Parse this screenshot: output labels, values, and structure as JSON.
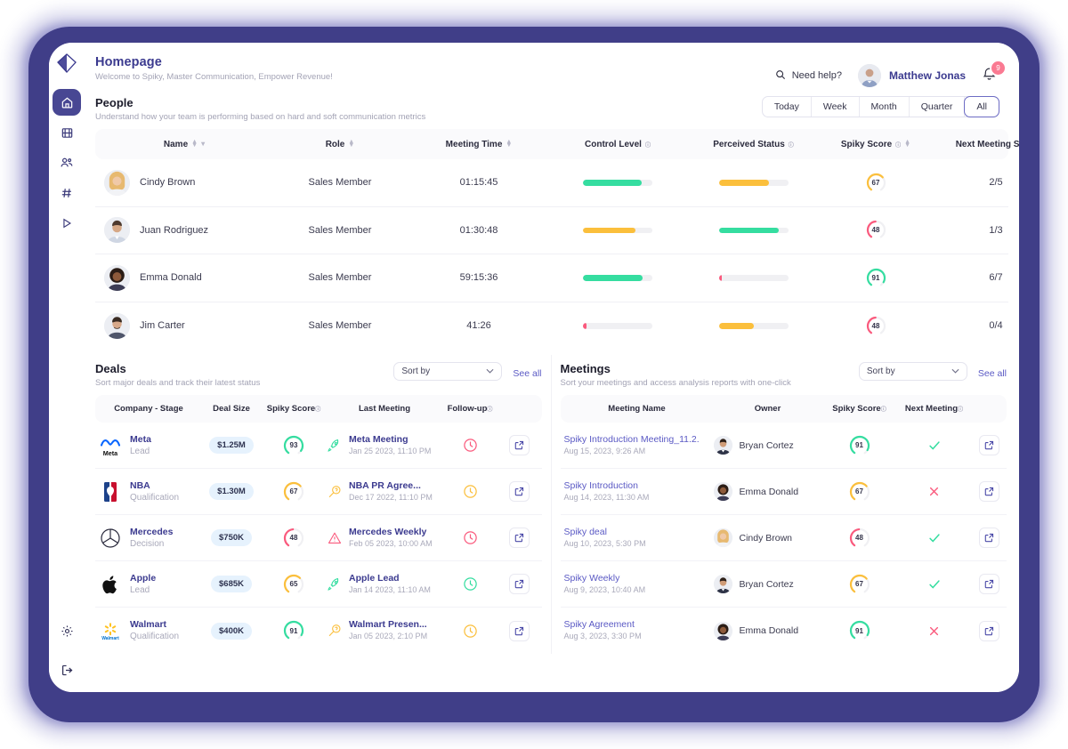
{
  "app": {
    "logo_icon": "spiky-prism-logo"
  },
  "sidebar": {
    "items": [
      {
        "name": "home",
        "icon": "home-icon",
        "active": true
      },
      {
        "name": "library",
        "icon": "film-grid-icon",
        "active": false
      },
      {
        "name": "teams",
        "icon": "people-icon",
        "active": false
      },
      {
        "name": "channels",
        "icon": "hash-icon",
        "active": false
      },
      {
        "name": "recordings",
        "icon": "play-icon",
        "active": false
      }
    ],
    "bottom": [
      {
        "name": "settings",
        "icon": "gear-icon"
      },
      {
        "name": "logout",
        "icon": "logout-icon"
      }
    ]
  },
  "header": {
    "title": "Homepage",
    "subtitle": "Welcome to Spiky, Master Communication, Empower Revenue!",
    "need_help": "Need help?",
    "search_icon": "search-icon",
    "user_name": "Matthew Jonas",
    "bell_icon": "bell-icon",
    "notification_count": "9"
  },
  "people": {
    "title": "People",
    "subtitle": "Understand how your team is performing based on hard and soft communication metrics",
    "period_tabs": [
      {
        "label": "Today",
        "active": false
      },
      {
        "label": "Week",
        "active": false
      },
      {
        "label": "Month",
        "active": false
      },
      {
        "label": "Quarter",
        "active": false
      },
      {
        "label": "All",
        "active": true
      }
    ],
    "columns": [
      {
        "label": "Name",
        "sortable": true,
        "filter": true,
        "info": false
      },
      {
        "label": "Role",
        "sortable": true,
        "filter": false,
        "info": false
      },
      {
        "label": "Meeting Time",
        "sortable": true,
        "filter": false,
        "info": false
      },
      {
        "label": "Control Level",
        "sortable": false,
        "filter": false,
        "info": true
      },
      {
        "label": "Perceived Status",
        "sortable": false,
        "filter": false,
        "info": true
      },
      {
        "label": "Spiky Score",
        "sortable": true,
        "filter": false,
        "info": true
      },
      {
        "label": "Next Meeting Set",
        "sortable": false,
        "filter": false,
        "info": true
      }
    ],
    "rows": [
      {
        "name": "Cindy Brown",
        "role": "Sales Member",
        "meeting_time": "01:15:45",
        "control_level": 84,
        "control_color": "#35ddA0",
        "perceived_status": 72,
        "perceived_color": "#fbbf3c",
        "spiky_score": 67,
        "spiky_color": "#fbbf3c",
        "next_meeting_set": "2/5",
        "avatar": "avatar-cindy-brown"
      },
      {
        "name": "Juan Rodriguez",
        "role": "Sales Member",
        "meeting_time": "01:30:48",
        "control_level": 76,
        "control_color": "#fbbf3c",
        "perceived_status": 86,
        "perceived_color": "#35ddA0",
        "spiky_score": 48,
        "spiky_color": "#fa5a7d",
        "next_meeting_set": "1/3",
        "avatar": "avatar-juan-rodriguez"
      },
      {
        "name": "Emma Donald",
        "role": "Sales Member",
        "meeting_time": "59:15:36",
        "control_level": 86,
        "control_color": "#35ddA0",
        "perceived_status": 5,
        "perceived_color": "#fa5a7d",
        "spiky_score": 91,
        "spiky_color": "#35ddA0",
        "next_meeting_set": "6/7",
        "avatar": "avatar-emma-donald"
      },
      {
        "name": "Jim Carter",
        "role": "Sales Member",
        "meeting_time": "41:26",
        "control_level": 5,
        "control_color": "#fa5a7d",
        "perceived_status": 50,
        "perceived_color": "#fbbf3c",
        "spiky_score": 48,
        "spiky_color": "#fa5a7d",
        "next_meeting_set": "0/4",
        "avatar": "avatar-jim-carter"
      }
    ]
  },
  "deals": {
    "title": "Deals",
    "subtitle": "Sort major deals and track their latest status",
    "sort_by": "Sort by",
    "see_all": "See all",
    "columns": [
      {
        "label": "Company - Stage",
        "info": false
      },
      {
        "label": "Deal Size",
        "info": false
      },
      {
        "label": "Spiky Score",
        "info": true
      },
      {
        "label": "Last Meeting",
        "info": false
      },
      {
        "label": "Follow-up",
        "info": true
      }
    ],
    "rows": [
      {
        "company": "Meta",
        "stage": "Lead",
        "logo": "meta-logo",
        "deal_size": "$1.25M",
        "spiky_score": 93,
        "spiky_color": "#35ddA0",
        "meeting_name": "Meta Meeting",
        "meeting_date": "Jan 25 2023, 11:10 PM",
        "meeting_icon": "rocket-icon",
        "meeting_icon_color": "#35ddA0",
        "followup_icon": "clock-icon",
        "followup_color": "#fa5a7d"
      },
      {
        "company": "NBA",
        "stage": "Qualification",
        "logo": "nba-logo",
        "deal_size": "$1.30M",
        "spiky_score": 67,
        "spiky_color": "#fbbf3c",
        "meeting_name": "NBA PR Agree...",
        "meeting_date": "Dec 17 2022, 11:10 PM",
        "meeting_icon": "magnifier-question-icon",
        "meeting_icon_color": "#fbbf3c",
        "followup_icon": "clock-icon",
        "followup_color": "#fbbf3c"
      },
      {
        "company": "Mercedes",
        "stage": "Decision",
        "logo": "mercedes-logo",
        "deal_size": "$750K",
        "spiky_score": 48,
        "spiky_color": "#fa5a7d",
        "meeting_name": "Mercedes Weekly",
        "meeting_date": "Feb 05 2023, 10:00 AM",
        "meeting_icon": "warning-triangle-icon",
        "meeting_icon_color": "#fa5a7d",
        "followup_icon": "clock-icon",
        "followup_color": "#fa5a7d"
      },
      {
        "company": "Apple",
        "stage": "Lead",
        "logo": "apple-logo",
        "deal_size": "$685K",
        "spiky_score": 65,
        "spiky_color": "#fbbf3c",
        "meeting_name": "Apple Lead",
        "meeting_date": "Jan 14 2023, 11:10 AM",
        "meeting_icon": "rocket-icon",
        "meeting_icon_color": "#35ddA0",
        "followup_icon": "clock-icon",
        "followup_color": "#35ddA0"
      },
      {
        "company": "Walmart",
        "stage": "Qualification",
        "logo": "walmart-logo",
        "deal_size": "$400K",
        "spiky_score": 91,
        "spiky_color": "#35ddA0",
        "meeting_name": "Walmart Presen...",
        "meeting_date": "Jan 05 2023, 2:10 PM",
        "meeting_icon": "magnifier-question-icon",
        "meeting_icon_color": "#fbbf3c",
        "followup_icon": "clock-icon",
        "followup_color": "#fbbf3c"
      }
    ]
  },
  "meetings": {
    "title": "Meetings",
    "subtitle": "Sort your meetings and access analysis reports with one-click",
    "sort_by": "Sort by",
    "see_all": "See all",
    "columns": [
      {
        "label": "Meeting Name",
        "info": false
      },
      {
        "label": "Owner",
        "info": false
      },
      {
        "label": "Spiky Score",
        "info": true
      },
      {
        "label": "Next Meeting",
        "info": true
      }
    ],
    "rows": [
      {
        "name": "Spiky Introduction Meeting_11.2.",
        "date": "Aug 15, 2023, 9:26 AM",
        "owner": "Bryan Cortez",
        "avatar": "avatar-bryan-cortez",
        "spiky_score": 91,
        "spiky_color": "#35ddA0",
        "next_meeting": "check",
        "next_meeting_color": "#35ddA0"
      },
      {
        "name": "Spiky Introduction",
        "date": "Aug 14, 2023, 11:30 AM",
        "owner": "Emma Donald",
        "avatar": "avatar-emma-donald",
        "spiky_score": 67,
        "spiky_color": "#fbbf3c",
        "next_meeting": "cross",
        "next_meeting_color": "#fa5a7d"
      },
      {
        "name": "Spiky deal",
        "date": "Aug 10, 2023, 5:30 PM",
        "owner": "Cindy Brown",
        "avatar": "avatar-cindy-brown",
        "spiky_score": 48,
        "spiky_color": "#fa5a7d",
        "next_meeting": "check",
        "next_meeting_color": "#35ddA0"
      },
      {
        "name": "Spiky Weekly",
        "date": "Aug 9, 2023, 10:40 AM",
        "owner": "Bryan Cortez",
        "avatar": "avatar-bryan-cortez",
        "spiky_score": 67,
        "spiky_color": "#fbbf3c",
        "next_meeting": "check",
        "next_meeting_color": "#35ddA0"
      },
      {
        "name": "Spiky Agreement",
        "date": "Aug 3, 2023, 3:30 PM",
        "owner": "Emma Donald",
        "avatar": "avatar-emma-donald",
        "spiky_score": 91,
        "spiky_color": "#35ddA0",
        "next_meeting": "cross",
        "next_meeting_color": "#fa5a7d"
      }
    ]
  },
  "colors": {
    "brand_purple": "#403e88",
    "accent_indigo": "#5a59c4",
    "green": "#35ddA0",
    "amber": "#fbbf3c",
    "red": "#fa5a7d",
    "pill_blue": "#e6f2fd",
    "badge_pink": "#fa7a92"
  }
}
